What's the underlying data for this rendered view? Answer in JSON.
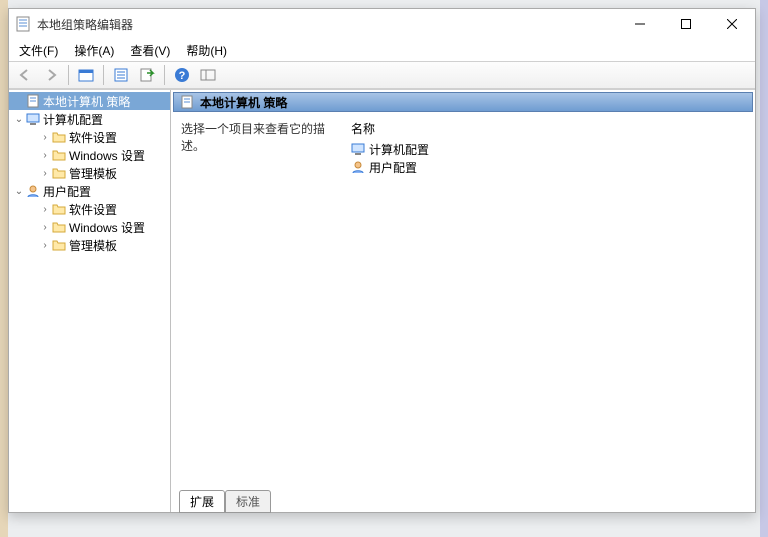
{
  "title": "本地组策略编辑器",
  "menu": {
    "file": "文件(F)",
    "action": "操作(A)",
    "view": "查看(V)",
    "help": "帮助(H)"
  },
  "tree": {
    "root": "本地计算机 策略",
    "comp": "计算机配置",
    "comp_sw": "软件设置",
    "comp_win": "Windows 设置",
    "comp_adm": "管理模板",
    "user": "用户配置",
    "user_sw": "软件设置",
    "user_win": "Windows 设置",
    "user_adm": "管理模板"
  },
  "right": {
    "header": "本地计算机 策略",
    "desc": "选择一个项目来查看它的描述。",
    "col_name": "名称",
    "item1": "计算机配置",
    "item2": "用户配置"
  },
  "tabs": {
    "ext": "扩展",
    "std": "标准"
  }
}
